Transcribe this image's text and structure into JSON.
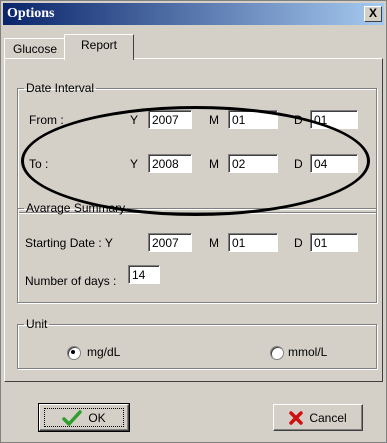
{
  "window": {
    "title": "Options",
    "close_glyph": "X"
  },
  "tabs": [
    {
      "label": "Glucose",
      "active": false
    },
    {
      "label": "Report",
      "active": true
    }
  ],
  "date_interval": {
    "legend": "Date Interval",
    "from": {
      "label": "From :",
      "y_label": "Y",
      "y_value": "2007",
      "m_label": "M",
      "m_value": "01",
      "d_label": "D",
      "d_value": "01"
    },
    "to": {
      "label": "To :",
      "y_label": "Y",
      "y_value": "2008",
      "m_label": "M",
      "m_value": "02",
      "d_label": "D",
      "d_value": "04"
    }
  },
  "average_summary": {
    "legend": "Avarage Summary",
    "starting_label": "Starting Date : Y",
    "y_value": "2007",
    "m_label": "M",
    "m_value": "01",
    "d_label": "D",
    "d_value": "01",
    "days_label": "Number of days :",
    "days_value": "14"
  },
  "unit": {
    "legend": "Unit",
    "options": [
      {
        "label": "mg/dL",
        "selected": true
      },
      {
        "label": "mmol/L",
        "selected": false
      }
    ]
  },
  "buttons": {
    "ok": "OK",
    "cancel": "Cancel"
  },
  "icons": {
    "ok": "check-icon",
    "cancel": "x-icon"
  },
  "colors": {
    "titlebar_start": "#0a246a",
    "titlebar_end": "#a6caf0",
    "check": "#2e9e2e",
    "cancel_x": "#d01010"
  }
}
